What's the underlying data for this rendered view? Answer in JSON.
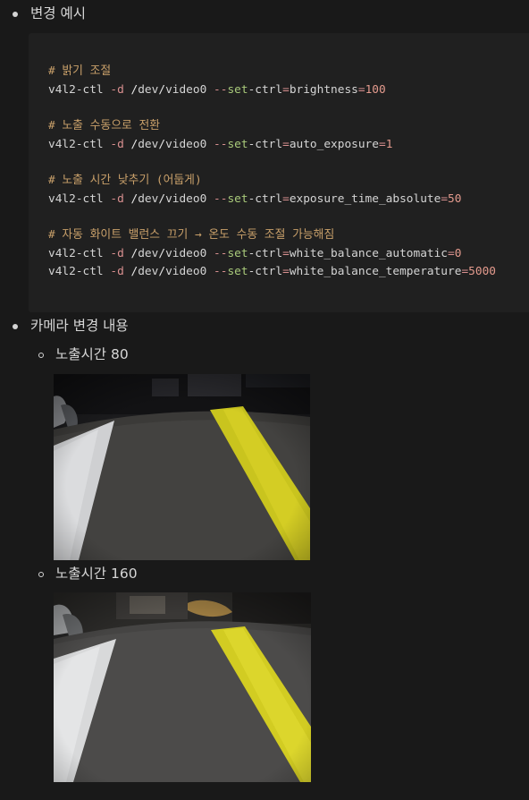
{
  "sections": [
    {
      "label": "변경 예시"
    },
    {
      "label": "카메라 변경 내용"
    }
  ],
  "code": {
    "lines": [
      {
        "kind": "comment",
        "text": "# 밝기 조절"
      },
      {
        "kind": "cmd",
        "prog": "v4l2-ctl",
        "flag": "-d",
        "path_slash1": "/",
        "path_dev": "dev",
        "path_slash2": "/",
        "path_video": "video0",
        "opt_dash": "--",
        "opt_kw": "set",
        "opt_rest": "-ctrl",
        "eq": "=",
        "ctrl": "brightness",
        "eq2": "=",
        "val": "100"
      },
      {
        "kind": "comment",
        "text": "# 노출 수동으로 전환"
      },
      {
        "kind": "cmd",
        "prog": "v4l2-ctl",
        "flag": "-d",
        "path_slash1": "/",
        "path_dev": "dev",
        "path_slash2": "/",
        "path_video": "video0",
        "opt_dash": "--",
        "opt_kw": "set",
        "opt_rest": "-ctrl",
        "eq": "=",
        "ctrl": "auto_exposure",
        "eq2": "=",
        "val": "1"
      },
      {
        "kind": "comment",
        "text": "# 노출 시간 낮추기 (어둡게)"
      },
      {
        "kind": "cmd",
        "prog": "v4l2-ctl",
        "flag": "-d",
        "path_slash1": "/",
        "path_dev": "dev",
        "path_slash2": "/",
        "path_video": "video0",
        "opt_dash": "--",
        "opt_kw": "set",
        "opt_rest": "-ctrl",
        "eq": "=",
        "ctrl": "exposure_time_absolute",
        "eq2": "=",
        "val": "50"
      },
      {
        "kind": "comment",
        "text": "# 자동 화이트 밸런스 끄기 → 온도 수동 조절 가능해짐"
      },
      {
        "kind": "cmd",
        "prog": "v4l2-ctl",
        "flag": "-d",
        "path_slash1": "/",
        "path_dev": "dev",
        "path_slash2": "/",
        "path_video": "video0",
        "opt_dash": "--",
        "opt_kw": "set",
        "opt_rest": "-ctrl",
        "eq": "=",
        "ctrl": "white_balance_automatic",
        "eq2": "=",
        "val": "0"
      },
      {
        "kind": "cmd",
        "prog": "v4l2-ctl",
        "flag": "-d",
        "path_slash1": "/",
        "path_dev": "dev",
        "path_slash2": "/",
        "path_video": "video0",
        "opt_dash": "--",
        "opt_kw": "set",
        "opt_rest": "-ctrl",
        "eq": "=",
        "ctrl": "white_balance_temperature",
        "eq2": "=",
        "val": "5000"
      }
    ]
  },
  "sub_items": [
    {
      "label": "노출시간 80"
    },
    {
      "label": "노출시간 160"
    }
  ]
}
